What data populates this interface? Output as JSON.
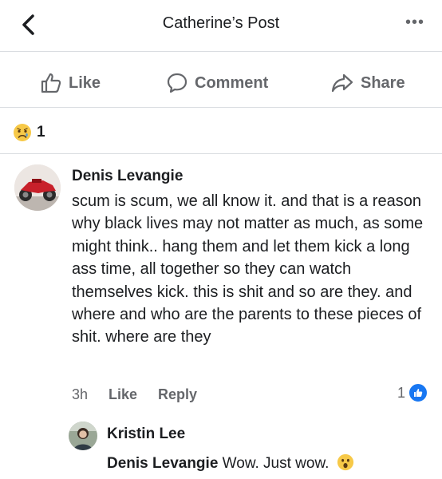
{
  "header": {
    "title": "Catherine’s Post",
    "more": "•••"
  },
  "actions": {
    "like": "Like",
    "comment": "Comment",
    "share": "Share"
  },
  "reactions": {
    "count": "1",
    "emoji_icon": "sad-face-icon"
  },
  "comment": {
    "author": "Denis Levangie",
    "text": "scum is scum, we all know it. and that is a reason why black lives may not matter as much, as some might think.. hang them and let them kick a long ass time, all together so they can watch themselves kick. this is shit and so are they. and where and who are the parents to these pieces of shit. where are they",
    "time": "3h",
    "like_label": "Like",
    "reply_label": "Reply",
    "like_count": "1"
  },
  "reply": {
    "author": "Kristin Lee",
    "mention": "Denis Levangie",
    "text": "Wow. Just wow.",
    "emoji_icon": "surprised-face-icon"
  },
  "colors": {
    "facebook_blue": "#1877f2",
    "muted_text": "#65676b",
    "divider": "#dadde1"
  }
}
